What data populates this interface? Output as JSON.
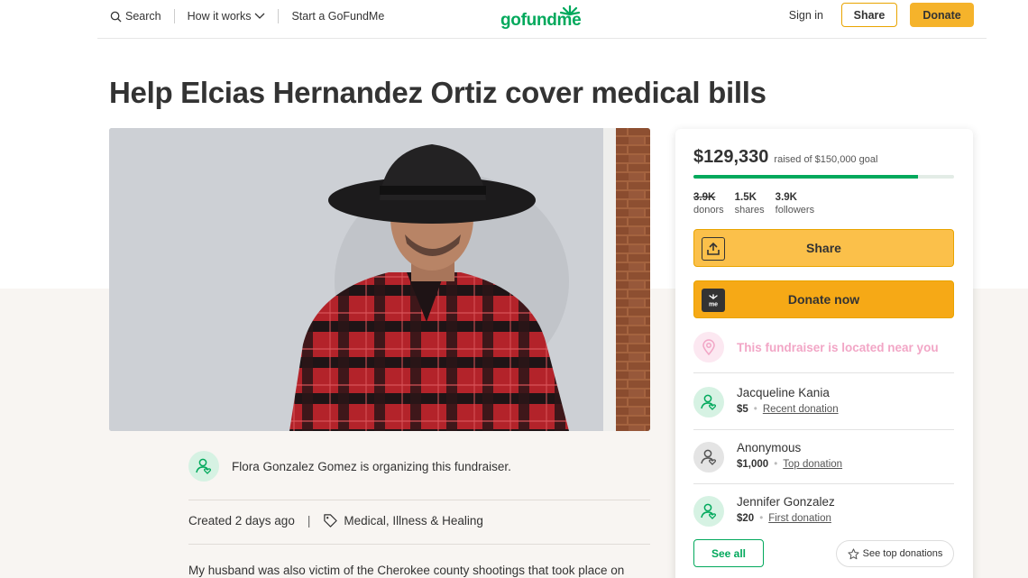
{
  "header": {
    "search_label": "Search",
    "how_it_works_label": "How it works",
    "start_label": "Start a GoFundMe",
    "logo_text": "gofundme",
    "signin_label": "Sign in",
    "share_label": "Share",
    "donate_label": "Donate"
  },
  "campaign": {
    "title": "Help Elcias Hernandez Ortiz cover medical bills",
    "organizer_text": "Flora Gonzalez Gomez is organizing this fundraiser.",
    "created": "Created 2 days ago",
    "separator": "|",
    "category": "Medical, Illness & Healing",
    "story_start": "My husband was also victim of the Cherokee county shootings that took place on"
  },
  "card": {
    "raised_amount": "$129,330",
    "raised_goal_text": "raised of $150,000 goal",
    "progress_fraction": 0.862,
    "stats": [
      {
        "value": "3.9K",
        "label": "donors"
      },
      {
        "value": "1.5K",
        "label": "shares"
      },
      {
        "value": "3.9K",
        "label": "followers"
      }
    ],
    "share_label": "Share",
    "donate_label": "Donate now",
    "location_text": "This fundraiser is located near you",
    "donations": [
      {
        "name": "Jacqueline Kania",
        "amount": "$5",
        "tag": "Recent donation"
      },
      {
        "name": "Anonymous",
        "amount": "$1,000",
        "tag": "Top donation"
      },
      {
        "name": "Jennifer Gonzalez",
        "amount": "$20",
        "tag": "First donation"
      }
    ],
    "see_all_label": "See all",
    "see_top_label": "See top donations"
  },
  "colors": {
    "brand_green": "#02a95c",
    "donate_orange": "#f5b32b",
    "location_pink": "#f2a6c6"
  },
  "icons": {
    "search": "search-icon",
    "chevron": "chevron-down-icon",
    "share": "share-icon",
    "donate": "gofundme-me-icon",
    "location": "location-pin-icon",
    "avatar": "user-heart-icon",
    "tag": "tag-icon",
    "star": "star-icon"
  }
}
